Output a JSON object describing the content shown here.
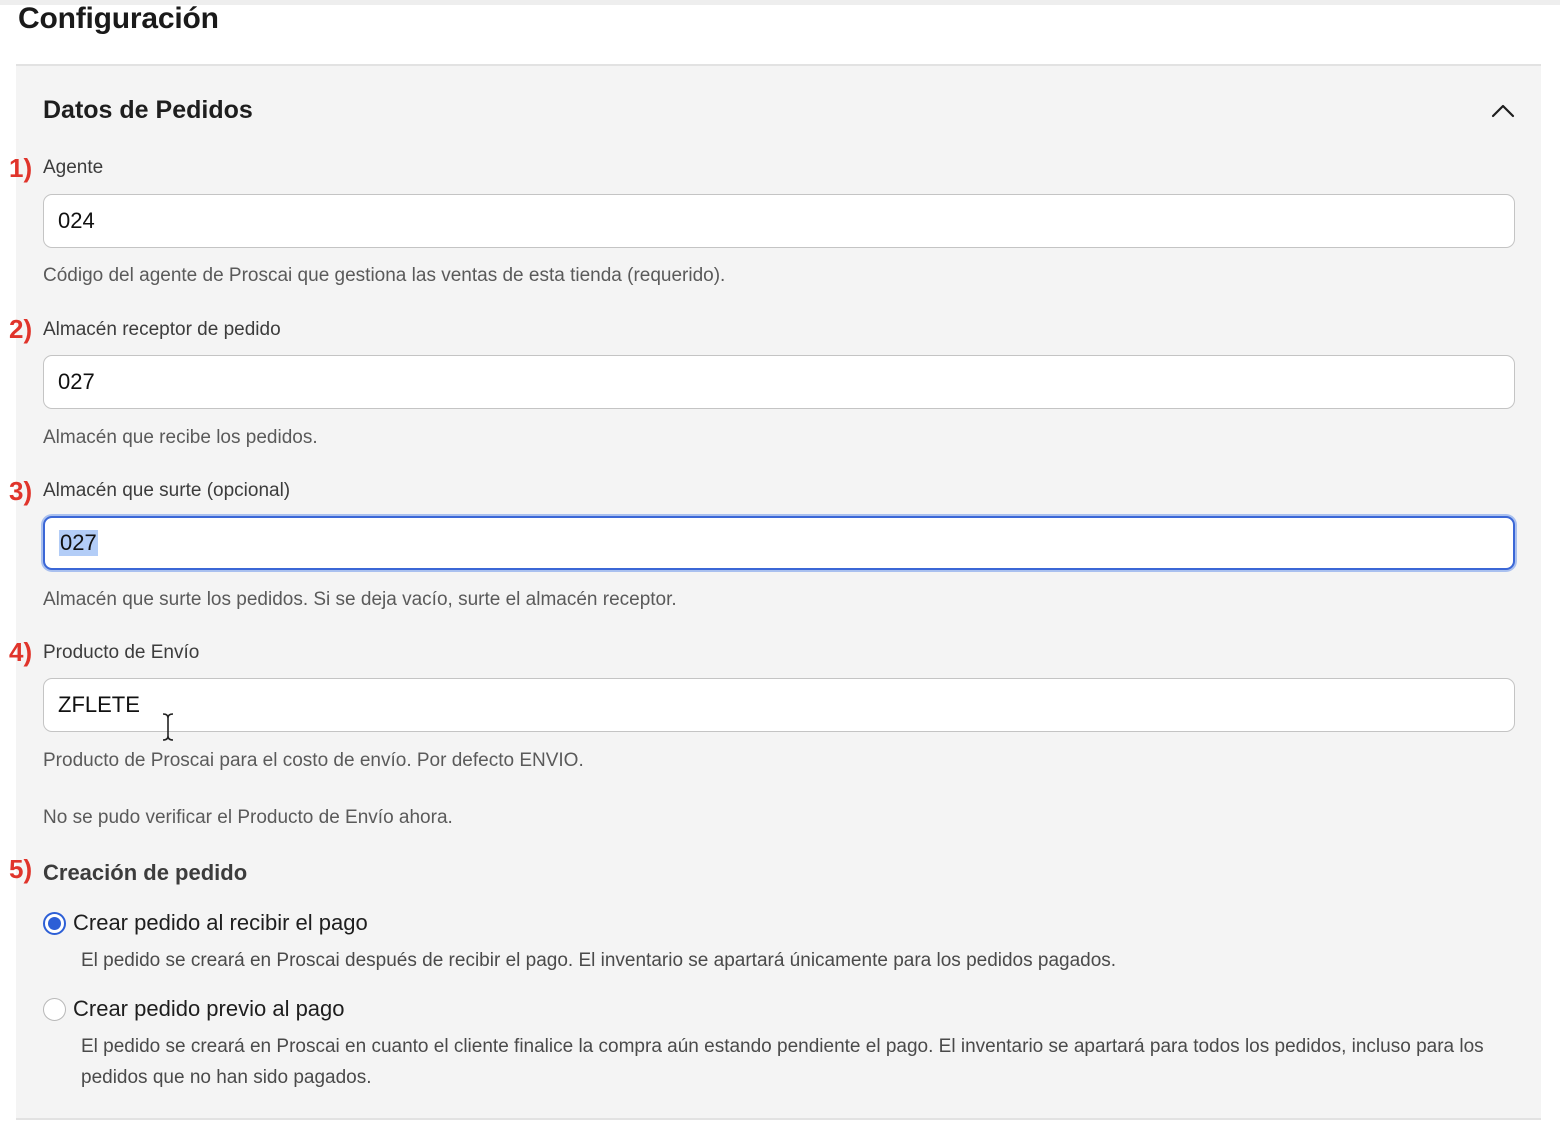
{
  "page": {
    "title": "Configuración"
  },
  "section": {
    "title": "Datos de Pedidos",
    "collapse_icon": "chevron-up-icon"
  },
  "markers": [
    "1)",
    "2)",
    "3)",
    "4)",
    "5)"
  ],
  "fields": {
    "agente": {
      "label": "Agente",
      "value": "024",
      "help": "Código del agente de Proscai que gestiona las ventas de esta tienda (requerido)."
    },
    "almacen_receptor": {
      "label": "Almacén receptor de pedido",
      "value": "027",
      "help": "Almacén que recibe los pedidos."
    },
    "almacen_surte": {
      "label": "Almacén que surte (opcional)",
      "value": "027",
      "help": "Almacén que surte los pedidos. Si se deja vacío, surte el almacén receptor.",
      "focused": true,
      "text_selected": true
    },
    "producto_envio": {
      "label": "Producto de Envío",
      "value": "ZFLETE",
      "help": "Producto de Proscai para el costo de envío. Por defecto ENVIO.",
      "warning": "No se pudo verificar el Producto de Envío ahora."
    }
  },
  "creacion": {
    "title": "Creación de pedido",
    "options": [
      {
        "label": "Crear pedido al recibir el pago",
        "description": "El pedido se creará en Proscai después de recibir el pago. El inventario se apartará únicamente para los pedidos pagados.",
        "checked": true
      },
      {
        "label": "Crear pedido previo al pago",
        "description": "El pedido se creará en Proscai en cuanto el cliente finalice la compra aún estando pendiente el pago. El inventario se apartará para todos los pedidos, incluso para los pedidos que no han sido pagados.",
        "checked": false
      }
    ]
  },
  "colors": {
    "marker": "#e0342b",
    "accent": "#2d5fd6",
    "panel_bg": "#f4f4f4"
  }
}
